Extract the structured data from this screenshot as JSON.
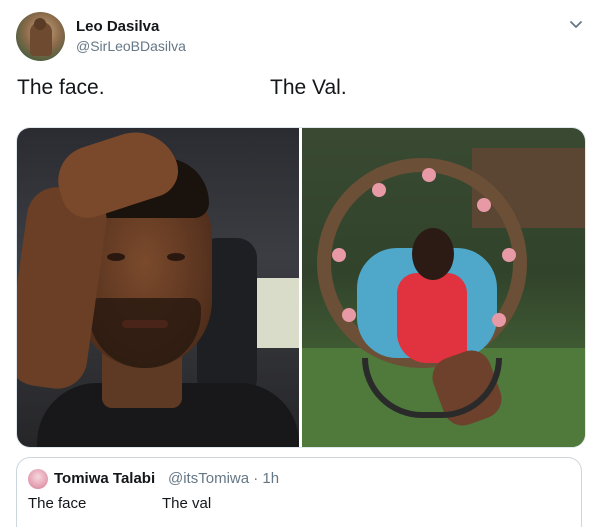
{
  "tweet": {
    "author_name": "Leo Dasilva",
    "author_handle": "@SirLeoBDasilva",
    "text_part1": "The face.",
    "text_part2": "The Val.",
    "menu_icon": "chevron-down-icon",
    "media": [
      {
        "id": "photo-left",
        "description_label": ""
      },
      {
        "id": "photo-right",
        "description_label": ""
      }
    ]
  },
  "quoted_tweet": {
    "author_name": "Tomiwa Talabi",
    "meta": "@itsTomiwa · 1h",
    "text_part1": "The face",
    "text_part2": "The val"
  },
  "colors": {
    "primary_text": "#14171a",
    "secondary_text": "#657786",
    "border": "#ccd6dd"
  }
}
